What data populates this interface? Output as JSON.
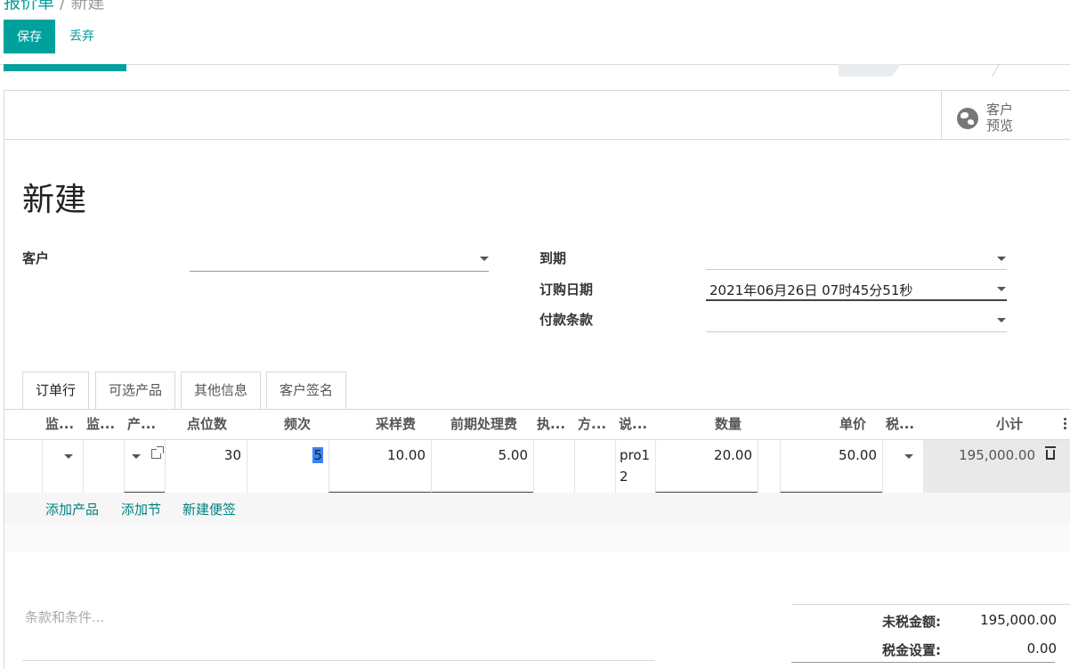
{
  "header": {
    "breadcrumb_root": "报价单",
    "breadcrumb_sep": " / ",
    "breadcrumb_current": "新建",
    "save_label": "保存",
    "discard_label": "丢弃"
  },
  "smart_button": {
    "icon": "globe-icon",
    "label": "客户\n预览"
  },
  "form": {
    "title": "新建",
    "customer_label": "客户",
    "customer_value": "",
    "expiry_label": "到期",
    "expiry_value": "",
    "order_date_label": "订购日期",
    "order_date_value": "2021年06月26日 07时45分51秒",
    "payment_terms_label": "付款条款",
    "payment_terms_value": ""
  },
  "tabs": [
    {
      "label": "订单行",
      "active": true
    },
    {
      "label": "可选产品",
      "active": false
    },
    {
      "label": "其他信息",
      "active": false
    },
    {
      "label": "客户签名",
      "active": false
    }
  ],
  "order_lines": {
    "columns": [
      "监...",
      "监...",
      "产...",
      "点位数",
      "频次",
      "采样费",
      "前期处理费",
      "执...",
      "方...",
      "说...",
      "数量",
      "单价",
      "税...",
      "小计"
    ],
    "rows": [
      {
        "points": "30",
        "frequency": "5",
        "sampling_fee": "10.00",
        "pretreatment_fee": "5.00",
        "description_1": "pro1",
        "description_2": "2",
        "quantity": "20.00",
        "unit_price": "50.00",
        "subtotal": "195,000.00"
      }
    ],
    "add_product": "添加产品",
    "add_section": "添加节",
    "add_note": "新建便签"
  },
  "footer": {
    "terms_placeholder": "条款和条件...",
    "untaxed_label": "未税金额:",
    "untaxed_value": "195,000.00",
    "tax_label": "税金设置:",
    "tax_value": "0.00"
  },
  "colors": {
    "primary": "#00A09D",
    "link": "#00827f"
  }
}
